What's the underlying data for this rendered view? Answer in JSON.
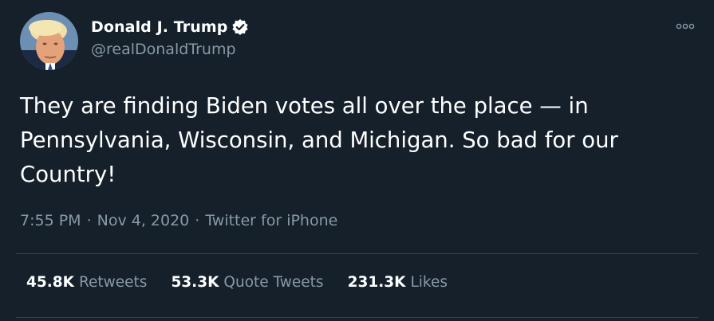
{
  "author": {
    "display_name": "Donald J. Trump",
    "handle": "@realDonaldTrump",
    "verified": true,
    "avatar_icon": "profile-photo"
  },
  "tweet": {
    "text": "They are finding Biden votes all over the place — in\nPennsylvania, Wisconsin, and Michigan. So bad for our\nCountry!",
    "time": "7:55 PM",
    "date": "Nov 4, 2020",
    "source": "Twitter for iPhone"
  },
  "stats": [
    {
      "value": "45.8K",
      "label": "Retweets"
    },
    {
      "value": "53.3K",
      "label": "Quote Tweets"
    },
    {
      "value": "231.3K",
      "label": "Likes"
    }
  ],
  "icons": {
    "verified": "verified-badge-icon",
    "more": "more-options-icon"
  },
  "colors": {
    "background": "#15202b",
    "secondary_text": "#8899a6",
    "divider": "#38444d"
  }
}
